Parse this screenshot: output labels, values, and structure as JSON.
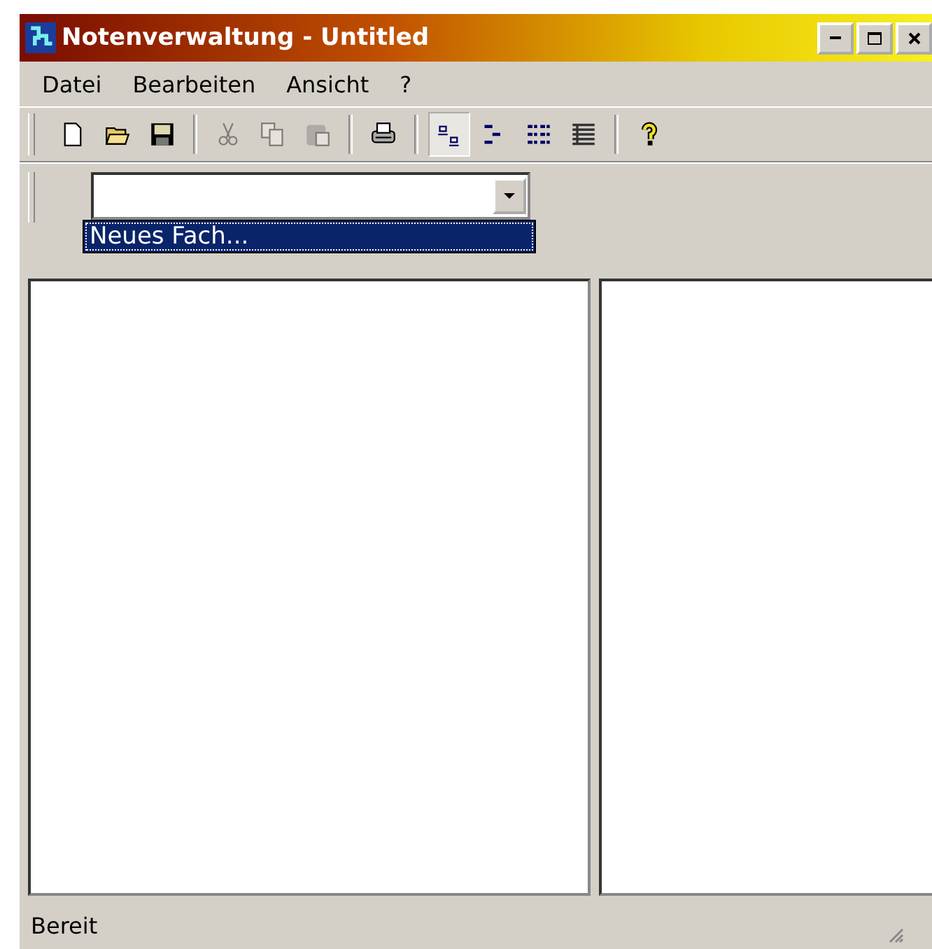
{
  "window": {
    "title": "Notenverwaltung - Untitled"
  },
  "menu": [
    {
      "label": "Datei"
    },
    {
      "label": "Bearbeiten"
    },
    {
      "label": "Ansicht"
    },
    {
      "label": "?"
    }
  ],
  "toolbar": [
    {
      "kind": "new",
      "disabled": false,
      "pressed": false
    },
    {
      "kind": "open",
      "disabled": false,
      "pressed": false
    },
    {
      "kind": "save",
      "disabled": false,
      "pressed": false
    },
    {
      "kind": "sep"
    },
    {
      "kind": "cut",
      "disabled": true,
      "pressed": false
    },
    {
      "kind": "copy",
      "disabled": true,
      "pressed": false
    },
    {
      "kind": "paste",
      "disabled": true,
      "pressed": false
    },
    {
      "kind": "sep"
    },
    {
      "kind": "print",
      "disabled": false,
      "pressed": false
    },
    {
      "kind": "sep"
    },
    {
      "kind": "largeicons",
      "disabled": false,
      "pressed": true
    },
    {
      "kind": "smallicons",
      "disabled": false,
      "pressed": false
    },
    {
      "kind": "list",
      "disabled": false,
      "pressed": false
    },
    {
      "kind": "details",
      "disabled": false,
      "pressed": false
    },
    {
      "kind": "sep"
    },
    {
      "kind": "help",
      "disabled": false,
      "pressed": false
    }
  ],
  "combo": {
    "dropdown": [
      {
        "label": "Neues Fach...",
        "selected": true
      }
    ]
  },
  "status_bar": {
    "text": "Bereit"
  }
}
